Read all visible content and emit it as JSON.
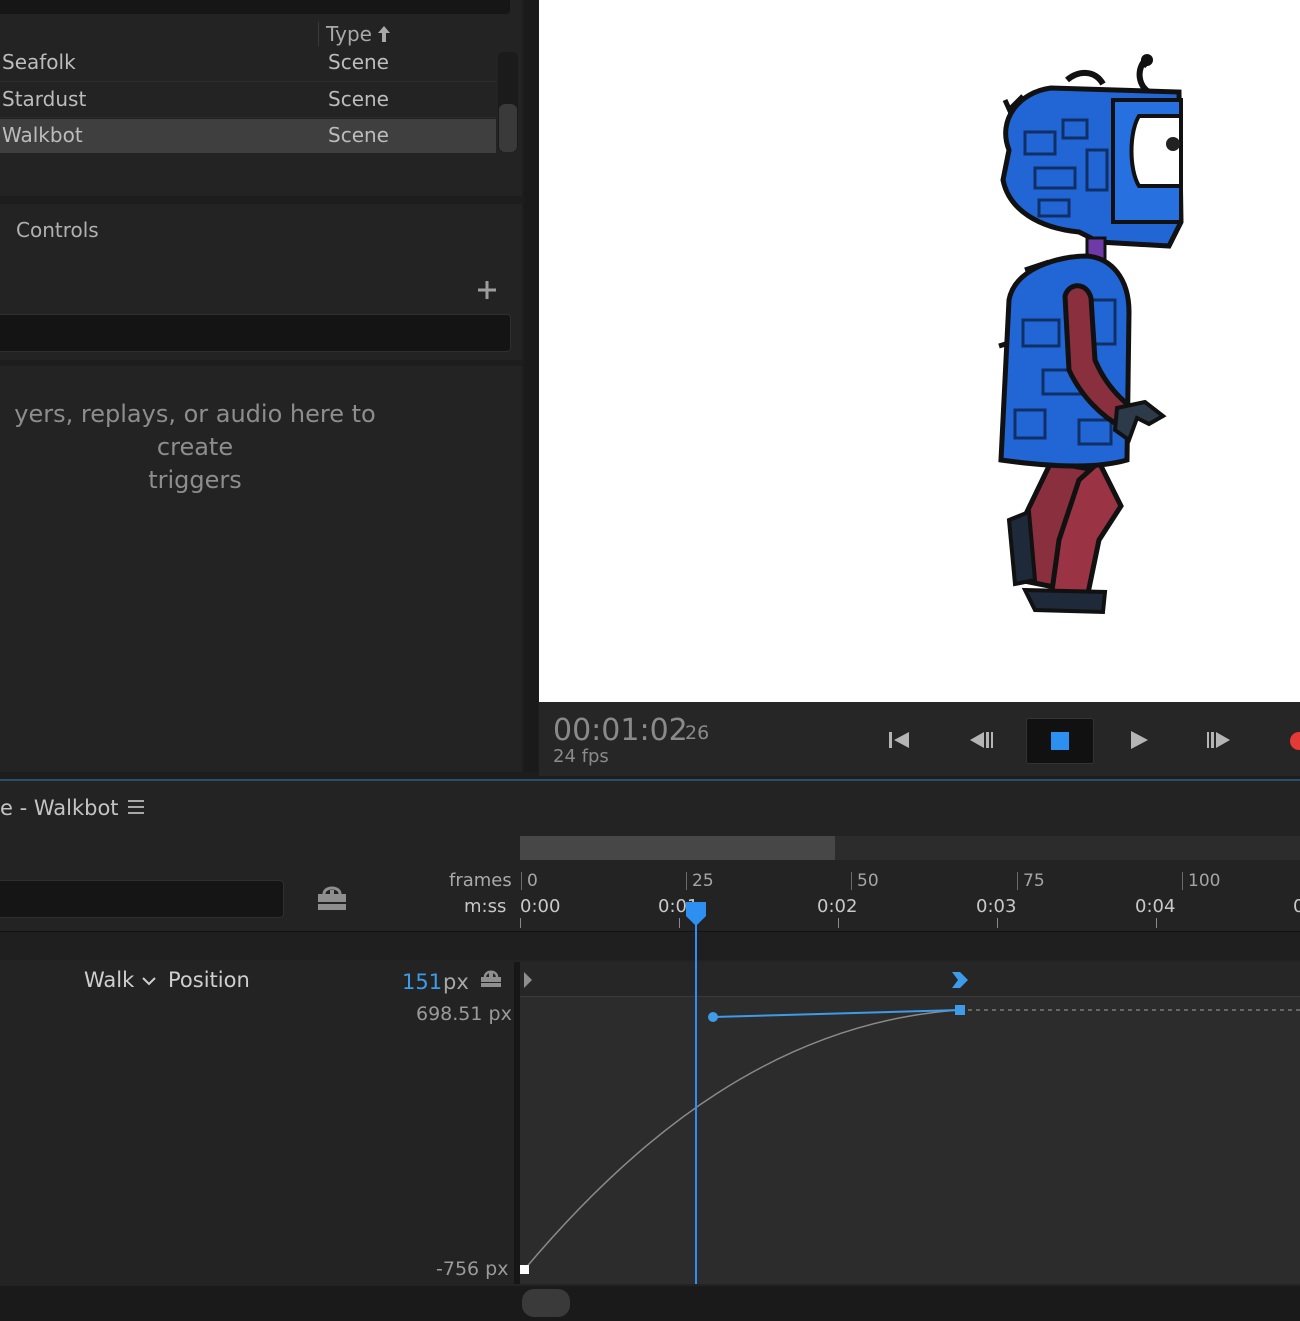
{
  "project": {
    "type_header": "Type",
    "rows": [
      {
        "name": "Seafolk",
        "type": "Scene"
      },
      {
        "name": "Stardust",
        "type": "Scene"
      },
      {
        "name": "Walkbot",
        "type": "Scene"
      }
    ]
  },
  "controls": {
    "title": "Controls"
  },
  "triggers": {
    "hint_line1": "yers, replays, or audio here to create",
    "hint_line2": "triggers"
  },
  "transport": {
    "timecode": "00:01:02",
    "frame": "26",
    "fps": "24 fps"
  },
  "timeline": {
    "title": "e - Walkbot",
    "frames_label": "frames",
    "mss_label": "m:ss",
    "frame_ticks": [
      "0",
      "25",
      "50",
      "75",
      "100"
    ],
    "time_ticks": [
      "0:00",
      "0:01",
      "0:02",
      "0:03",
      "0:04",
      "0"
    ],
    "track": {
      "group": "Walk",
      "property": "Position",
      "value": "151",
      "unit": "px",
      "graph_max": "698.51 px",
      "graph_min": "-756 px"
    }
  },
  "colors": {
    "accent": "#3d9be9",
    "record": "#e53935",
    "selected_row": "#3f3f3f"
  },
  "icons": {
    "sort": "arrow-up-icon",
    "add": "plus-icon",
    "go_start": "skip-to-start-icon",
    "step_back": "step-back-icon",
    "stop": "stop-icon",
    "play": "play-icon",
    "step_forward": "step-forward-icon",
    "record": "record-icon",
    "menu": "hamburger-icon",
    "lock": "lock-icon"
  }
}
